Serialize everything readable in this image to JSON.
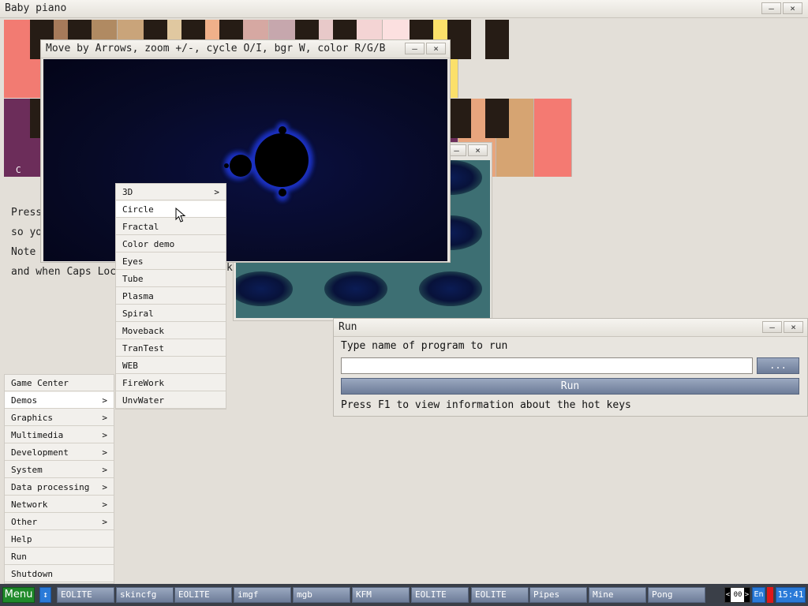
{
  "piano": {
    "title": "Baby piano",
    "note_label": "C",
    "text_lines": [
      "Press",
      "so yo",
      "Note",
      "and when Caps Loc"
    ],
    "text_k": "k",
    "colors": {
      "top": [
        "#f27b72",
        "#a67a5a",
        "#b08a62",
        "#c9a47a",
        "#e0c8a0",
        "#f0b08a",
        "#d6a8a2",
        "#c6a7ad",
        "#e8c9c9",
        "#f4d4d4",
        "#fce0e0",
        "#fbe06a"
      ],
      "bottom": [
        "#6c2d5a",
        "#e8a57d",
        "#d6a472",
        "#f47a72"
      ]
    }
  },
  "fractal": {
    "title": "Move by Arrows, zoom +/-, cycle O/I, bgr W, color R/G/B"
  },
  "plasma": {
    "title": ""
  },
  "run": {
    "title": "Run",
    "prompt": "Type name of program to run",
    "input_value": "",
    "browse_label": "...",
    "run_label": "Run",
    "hint": "Press F1 to view information about the hot keys"
  },
  "window_buttons": {
    "minimize": "–",
    "close": "×"
  },
  "start_menu": {
    "items": [
      {
        "label": "Game Center",
        "arrow": ""
      },
      {
        "label": "Demos",
        "arrow": ">"
      },
      {
        "label": "Graphics",
        "arrow": ">"
      },
      {
        "label": "Multimedia",
        "arrow": ">"
      },
      {
        "label": "Development",
        "arrow": ">"
      },
      {
        "label": "System",
        "arrow": ">"
      },
      {
        "label": "Data processing",
        "arrow": ">"
      },
      {
        "label": "Network",
        "arrow": ">"
      },
      {
        "label": "Other",
        "arrow": ">"
      },
      {
        "label": "Help",
        "arrow": ""
      },
      {
        "label": "Run",
        "arrow": ""
      },
      {
        "label": "Shutdown",
        "arrow": ""
      }
    ]
  },
  "demos_menu": {
    "items": [
      {
        "label": "3D",
        "arrow": ">"
      },
      {
        "label": "Circle",
        "arrow": ""
      },
      {
        "label": "Fractal",
        "arrow": ""
      },
      {
        "label": "Color demo",
        "arrow": ""
      },
      {
        "label": "Eyes",
        "arrow": ""
      },
      {
        "label": "Tube",
        "arrow": ""
      },
      {
        "label": "Plasma",
        "arrow": ""
      },
      {
        "label": "Spiral",
        "arrow": ""
      },
      {
        "label": "Moveback",
        "arrow": ""
      },
      {
        "label": "TranTest",
        "arrow": ""
      },
      {
        "label": "WEB",
        "arrow": ""
      },
      {
        "label": "FireWork",
        "arrow": ""
      },
      {
        "label": "UnvWater",
        "arrow": ""
      }
    ]
  },
  "taskbar": {
    "menu_label": "Menu",
    "arrow_label": "↕",
    "tasks": [
      "EOLITE",
      "skincfg",
      "EOLITE",
      "imgf",
      "mgb",
      "KFM",
      "EOLITE",
      "EOLITE",
      "Pipes",
      "Mine",
      "Pong"
    ],
    "counter": "00",
    "lang": "En",
    "clock": "15:41"
  }
}
